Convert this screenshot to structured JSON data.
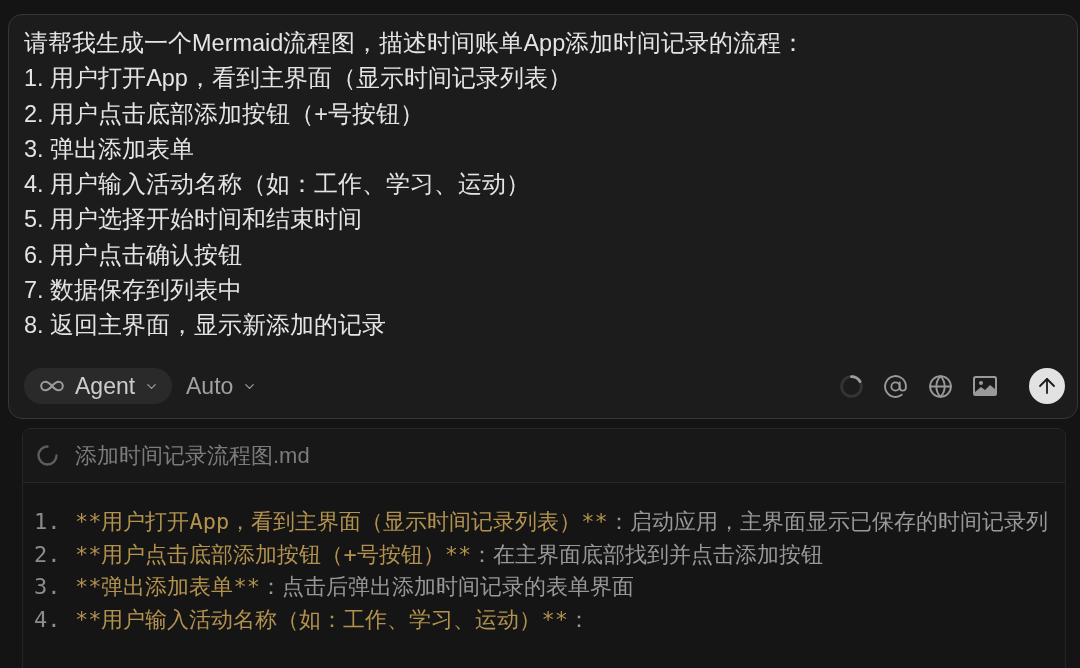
{
  "prompt": {
    "lines": [
      "请帮我生成一个Mermaid流程图，描述时间账单App添加时间记录的流程：",
      "1. 用户打开App，看到主界面（显示时间记录列表）",
      "2. 用户点击底部添加按钮（+号按钮）",
      "3. 弹出添加表单",
      "4. 用户输入活动名称（如：工作、学习、运动）",
      "5. 用户选择开始时间和结束时间",
      "6. 用户点击确认按钮",
      "7. 数据保存到列表中",
      "8. 返回主界面，显示新添加的记录"
    ]
  },
  "toolbar": {
    "mode": {
      "label": "Agent"
    },
    "model": {
      "label": "Auto"
    }
  },
  "file": {
    "name": "添加时间记录流程图.md",
    "lines": [
      {
        "number": "1.",
        "segments": [
          {
            "kind": "strong",
            "text": "**用户打开App，看到主界面（显示时间记录列表）**"
          },
          {
            "kind": "plain",
            "text": "：启动应用，主界面显示已保存的时间记录列"
          }
        ]
      },
      {
        "number": "2.",
        "segments": [
          {
            "kind": "strong",
            "text": "**用户点击底部添加按钮（+号按钮）**"
          },
          {
            "kind": "plain",
            "text": "：在主界面底部找到并点击添加按钮"
          }
        ]
      },
      {
        "number": "3.",
        "segments": [
          {
            "kind": "strong",
            "text": "**弹出添加表单**"
          },
          {
            "kind": "plain",
            "text": "：点击后弹出添加时间记录的表单界面"
          }
        ]
      },
      {
        "number": "4.",
        "segments": [
          {
            "kind": "strong",
            "text": "**用户输入活动名称（如：工作、学习、运动）**"
          },
          {
            "kind": "plain",
            "text": "："
          }
        ]
      }
    ]
  }
}
